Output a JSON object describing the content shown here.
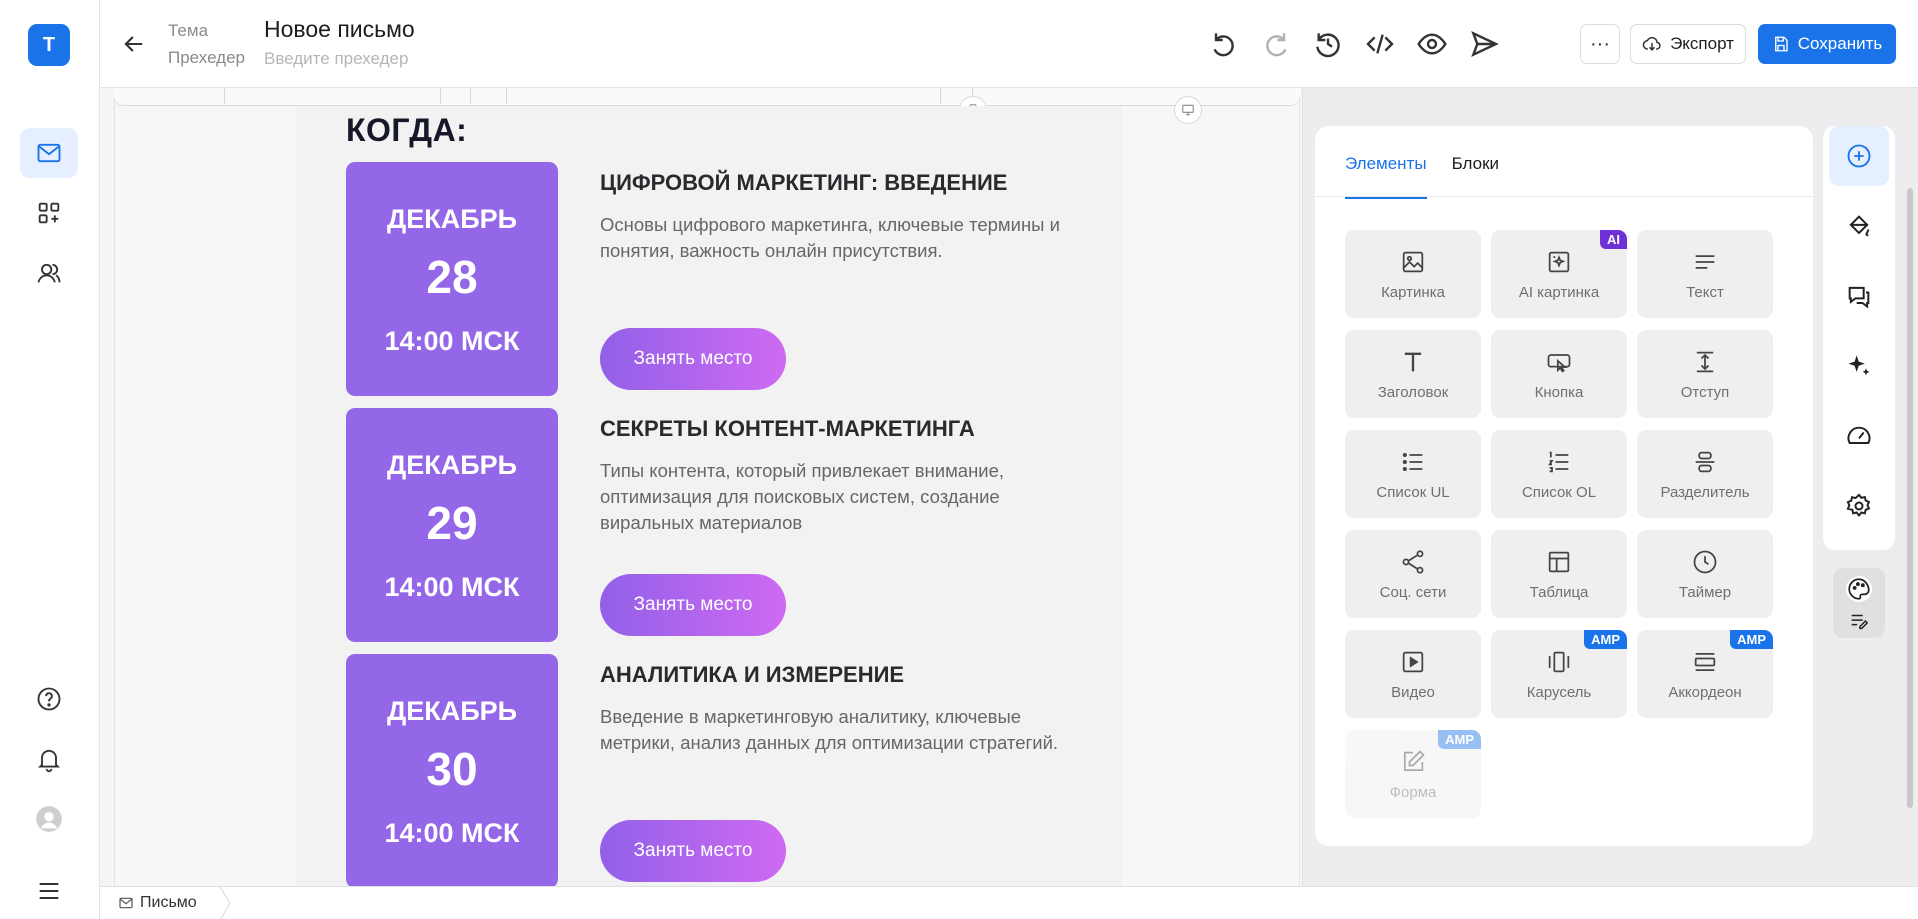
{
  "app": {
    "logo_letter": "T",
    "brand_color": "#1a73e8"
  },
  "rail": {
    "items": [
      {
        "icon": "mail-icon",
        "active": true
      },
      {
        "icon": "apps-add-icon",
        "active": false
      },
      {
        "icon": "contacts-icon",
        "active": false
      }
    ],
    "bottom": [
      {
        "icon": "help-icon"
      },
      {
        "icon": "bell-icon"
      },
      {
        "icon": "avatar"
      },
      {
        "icon": "menu-icon"
      }
    ]
  },
  "header": {
    "subject_label": "Тема",
    "preheader_label": "Прехедер",
    "title": "Новое письмо",
    "preheader_placeholder": "Введите прехедер",
    "more_label": "···",
    "export_label": "Экспорт",
    "save_label": "Сохранить"
  },
  "email": {
    "heading": "КОГДА:",
    "events": [
      {
        "month": "ДЕКАБРЬ",
        "day": "28",
        "time": "14:00 МСК",
        "title": "ЦИФРОВОЙ МАРКЕТИНГ: ВВЕДЕНИЕ",
        "description": "Основы цифрового маркетинга, ключевые термины и понятия, важность онлайн присутствия.",
        "button": "Занять место"
      },
      {
        "month": "ДЕКАБРЬ",
        "day": "29",
        "time": "14:00 МСК",
        "title": "СЕКРЕТЫ КОНТЕНТ-МАРКЕТИНГА",
        "description": "Типы контента, который привлекает внимание, оптимизация для поисковых систем, создание виральных материалов",
        "button": "Занять место"
      },
      {
        "month": "ДЕКАБРЬ",
        "day": "30",
        "time": "14:00 МСК",
        "title": "АНАЛИТИКА И ИЗМЕРЕНИЕ",
        "description": "Введение в маркетинговую аналитику, ключевые метрики, анализ данных для оптимизации стратегий.",
        "button": "Занять место"
      }
    ]
  },
  "panel": {
    "tabs": [
      {
        "label": "Элементы",
        "active": true
      },
      {
        "label": "Блоки",
        "active": false
      }
    ],
    "elements": [
      {
        "label": "Картинка",
        "icon": "image-icon"
      },
      {
        "label": "AI картинка",
        "icon": "ai-image-icon",
        "badge": "AI"
      },
      {
        "label": "Текст",
        "icon": "text-icon"
      },
      {
        "label": "Заголовок",
        "icon": "heading-icon"
      },
      {
        "label": "Кнопка",
        "icon": "button-icon"
      },
      {
        "label": "Отступ",
        "icon": "spacer-icon"
      },
      {
        "label": "Список UL",
        "icon": "list-ul-icon"
      },
      {
        "label": "Список OL",
        "icon": "list-ol-icon"
      },
      {
        "label": "Разделитель",
        "icon": "divider-icon"
      },
      {
        "label": "Соц. сети",
        "icon": "share-icon"
      },
      {
        "label": "Таблица",
        "icon": "table-icon"
      },
      {
        "label": "Таймер",
        "icon": "clock-icon"
      },
      {
        "label": "Видео",
        "icon": "video-icon"
      },
      {
        "label": "Карусель",
        "icon": "carousel-icon",
        "badge": "AMP"
      },
      {
        "label": "Аккордеон",
        "icon": "accordion-icon",
        "badge": "AMP"
      },
      {
        "label": "Форма",
        "icon": "form-icon",
        "badge": "AMP",
        "disabled": true
      }
    ]
  },
  "bottom": {
    "breadcrumb": "Письмо"
  }
}
